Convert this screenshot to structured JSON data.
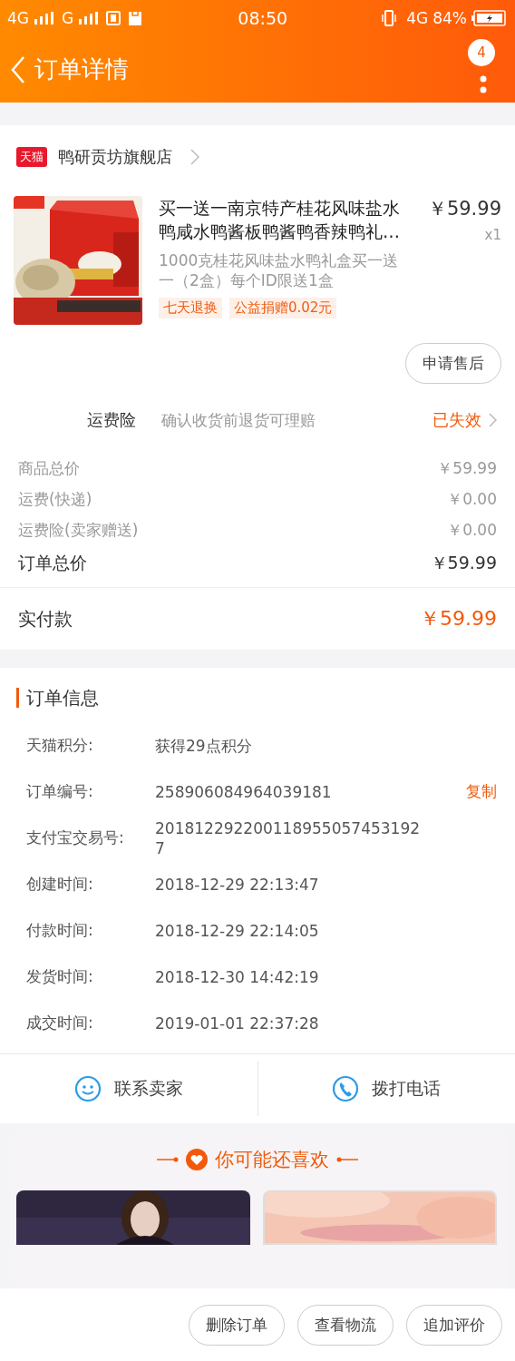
{
  "status_bar": {
    "network_1": "4G",
    "network_2": "G",
    "time": "08:50",
    "network_3": "4G",
    "battery": "84%"
  },
  "nav": {
    "title": "订单详情",
    "badge": "4"
  },
  "store": {
    "name": "鸭研贡坊旗舰店",
    "tag": "天猫"
  },
  "product": {
    "image": {
      "kind": "picture"
    },
    "title": "买一送一南京特产桂花风味盐水鸭咸水鸭酱板鸭酱鸭香辣鸭礼…",
    "price": "￥59.99",
    "quantity": "x1",
    "sku": "1000克桂花风味盐水鸭礼盒买一送一（2盒）每个ID限送1盒",
    "tags": [
      "七天退换",
      "公益捐赠0.02元"
    ],
    "action": "申请售后"
  },
  "insurance": {
    "label": "运费险",
    "description": "确认收货前退货可理赔",
    "status": "已失效"
  },
  "costs": [
    {
      "label": "商品总价",
      "value": "￥59.99",
      "kind": "minor"
    },
    {
      "label": "运费(快递)",
      "value": "￥0.00",
      "kind": "minor"
    },
    {
      "label": "运费险(卖家赠送)",
      "value": "￥0.00",
      "kind": "minor"
    },
    {
      "label": "订单总价",
      "value": "￥59.99",
      "kind": "major"
    }
  ],
  "paid": {
    "label": "实付款",
    "value": "￥59.99"
  },
  "order_info": {
    "title": "订单信息",
    "rows": [
      {
        "label": "天猫积分:",
        "value": "获得29点积分"
      },
      {
        "label": "订单编号:",
        "value": "258906084964039181",
        "action": "复制"
      },
      {
        "label": "支付宝交易号:",
        "value": "2018122922001189550574531927"
      },
      {
        "label": "创建时间:",
        "value": "2018-12-29 22:13:47"
      },
      {
        "label": "付款时间:",
        "value": "2018-12-29 22:14:05"
      },
      {
        "label": "发货时间:",
        "value": "2018-12-30 14:42:19"
      },
      {
        "label": "成交时间:",
        "value": "2019-01-01 22:37:28"
      }
    ]
  },
  "contact": [
    {
      "label": "联系卖家",
      "kind": "chat"
    },
    {
      "label": "拨打电话",
      "kind": "phone"
    }
  ],
  "recommend": {
    "title": "你可能还喜欢",
    "items": [
      {
        "kind": "picture"
      },
      {
        "kind": "picture"
      }
    ]
  },
  "bottom_buttons": [
    "删除订单",
    "查看物流",
    "追加评价"
  ]
}
